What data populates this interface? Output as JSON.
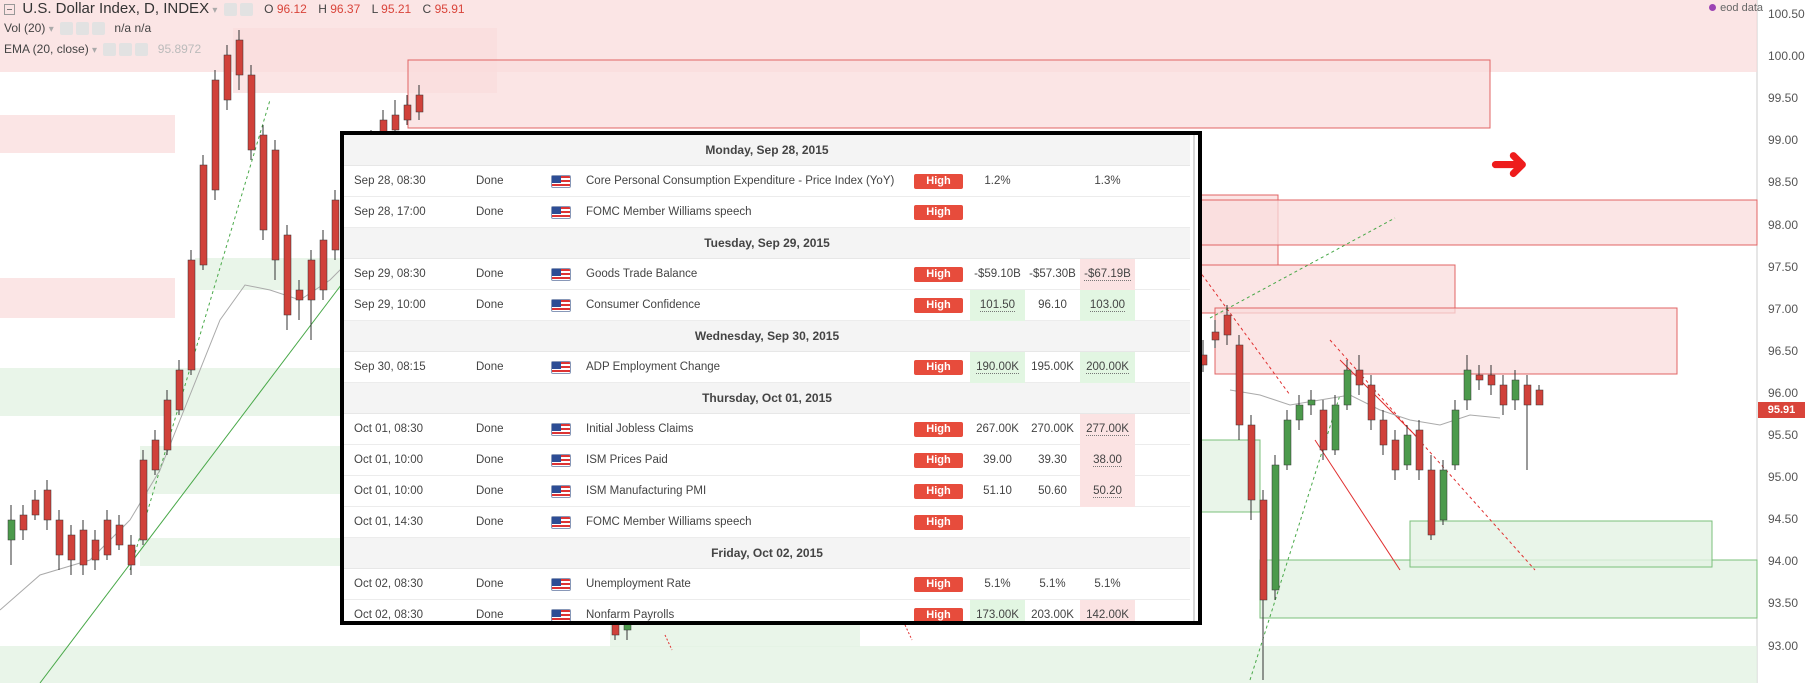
{
  "header": {
    "symbol": "U.S. Dollar Index, D, INDEX",
    "open_label": "O",
    "open": "96.12",
    "high_label": "H",
    "high": "96.37",
    "low_label": "L",
    "low": "95.21",
    "close_label": "C",
    "close": "95.91",
    "vol_label": "Vol (20)",
    "vol_values": "n/a n/a",
    "ema_label": "EMA (20, close)",
    "ema_value": "95.8972"
  },
  "watermark": "eod data",
  "price_axis": {
    "ticks": [
      "100.50",
      "100.00",
      "99.50",
      "99.00",
      "98.50",
      "98.00",
      "97.50",
      "97.00",
      "96.50",
      "96.00",
      "95.50",
      "95.00",
      "94.50",
      "94.00",
      "93.50",
      "93.00"
    ],
    "last_price": "95.91"
  },
  "colors": {
    "up": "#4c9a4c",
    "down": "#d0413a",
    "supply_zone": "#fadcdc",
    "demand_zone": "#e3f2e3",
    "impact_high": "#e74c3c",
    "arrow": "#ee1c1c"
  },
  "annotation_icon": "arrow-right-icon",
  "calendar": {
    "days": [
      {
        "label": "Monday, Sep 28, 2015",
        "events": [
          {
            "time": "Sep 28, 08:30",
            "status": "Done",
            "event": "Core Personal Consumption Expenditure - Price Index (YoY)",
            "impact": "High",
            "actual": "1.2%",
            "forecast": "",
            "previous": "1.3%",
            "actual_style": "",
            "previous_style": ""
          },
          {
            "time": "Sep 28, 17:00",
            "status": "Done",
            "event": "FOMC Member Williams speech",
            "impact": "High",
            "actual": "",
            "forecast": "",
            "previous": "",
            "actual_style": "",
            "previous_style": ""
          }
        ]
      },
      {
        "label": "Tuesday, Sep 29, 2015",
        "events": [
          {
            "time": "Sep 29, 08:30",
            "status": "Done",
            "event": "Goods Trade Balance",
            "impact": "High",
            "actual": "-$59.10B",
            "forecast": "-$57.30B",
            "previous": "-$67.19B",
            "actual_style": "",
            "previous_style": "red"
          },
          {
            "time": "Sep 29, 10:00",
            "status": "Done",
            "event": "Consumer Confidence",
            "impact": "High",
            "actual": "101.50",
            "forecast": "96.10",
            "previous": "103.00",
            "actual_style": "green",
            "previous_style": "green"
          }
        ]
      },
      {
        "label": "Wednesday, Sep 30, 2015",
        "events": [
          {
            "time": "Sep 30, 08:15",
            "status": "Done",
            "event": "ADP Employment Change",
            "impact": "High",
            "actual": "190.00K",
            "forecast": "195.00K",
            "previous": "200.00K",
            "actual_style": "green",
            "previous_style": "green"
          }
        ]
      },
      {
        "label": "Thursday, Oct 01, 2015",
        "events": [
          {
            "time": "Oct 01, 08:30",
            "status": "Done",
            "event": "Initial Jobless Claims",
            "impact": "High",
            "actual": "267.00K",
            "forecast": "270.00K",
            "previous": "277.00K",
            "actual_style": "",
            "previous_style": "red"
          },
          {
            "time": "Oct 01, 10:00",
            "status": "Done",
            "event": "ISM Prices Paid",
            "impact": "High",
            "actual": "39.00",
            "forecast": "39.30",
            "previous": "38.00",
            "actual_style": "",
            "previous_style": "red"
          },
          {
            "time": "Oct 01, 10:00",
            "status": "Done",
            "event": "ISM Manufacturing PMI",
            "impact": "High",
            "actual": "51.10",
            "forecast": "50.60",
            "previous": "50.20",
            "actual_style": "",
            "previous_style": "red"
          },
          {
            "time": "Oct 01, 14:30",
            "status": "Done",
            "event": "FOMC Member Williams speech",
            "impact": "High",
            "actual": "",
            "forecast": "",
            "previous": "",
            "actual_style": "",
            "previous_style": ""
          }
        ]
      },
      {
        "label": "Friday, Oct 02, 2015",
        "events": [
          {
            "time": "Oct 02, 08:30",
            "status": "Done",
            "event": "Unemployment Rate",
            "impact": "High",
            "actual": "5.1%",
            "forecast": "5.1%",
            "previous": "5.1%",
            "actual_style": "",
            "previous_style": ""
          },
          {
            "time": "Oct 02, 08:30",
            "status": "Done",
            "event": "Nonfarm Payrolls",
            "impact": "High",
            "actual": "173.00K",
            "forecast": "203.00K",
            "previous": "142.00K",
            "actual_style": "green",
            "previous_style": "red"
          }
        ]
      }
    ]
  }
}
